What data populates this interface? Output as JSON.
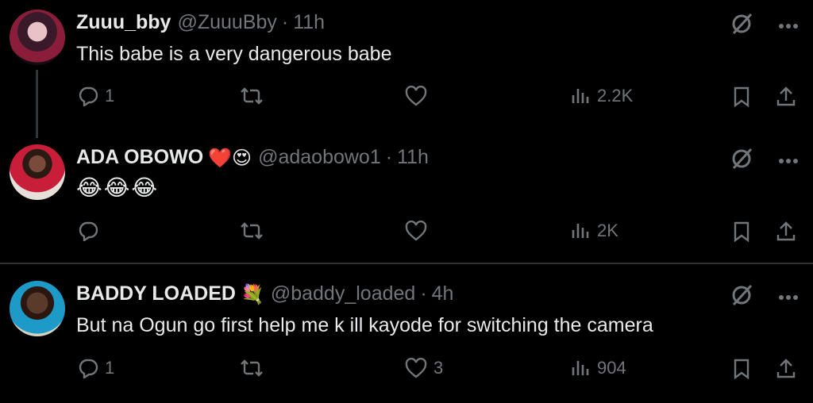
{
  "tweets": [
    {
      "name": "Zuuu_bby",
      "name_emoji": "",
      "handle": "@ZuuuBby",
      "separator": "·",
      "time": "11h",
      "text": "This babe is a very dangerous babe",
      "replies": "1",
      "retweets": "",
      "likes": "",
      "views": "2.2K"
    },
    {
      "name": "ADA OBOWO",
      "name_emoji": "❤️😍",
      "handle": "@adaobowo1",
      "separator": "·",
      "time": "11h",
      "text": "😂😂😂",
      "replies": "",
      "retweets": "",
      "likes": "",
      "views": "2K"
    },
    {
      "name": "BADDY LOADED",
      "name_emoji": "💐",
      "handle": "@baddy_loaded",
      "separator": "·",
      "time": "4h",
      "text": "But na Ogun go first help me k ill kayode for switching the camera",
      "replies": "1",
      "retweets": "",
      "likes": "3",
      "views": "904"
    }
  ],
  "icons": {
    "reply": "reply-icon",
    "retweet": "retweet-icon",
    "like": "like-icon",
    "views": "views-icon",
    "bookmark": "bookmark-icon",
    "share": "share-icon",
    "grok": "grok-icon",
    "more": "more-icon"
  },
  "colors": {
    "background": "#000000",
    "text": "#e7e9ea",
    "muted": "#71767b",
    "divider": "#2f3336"
  }
}
